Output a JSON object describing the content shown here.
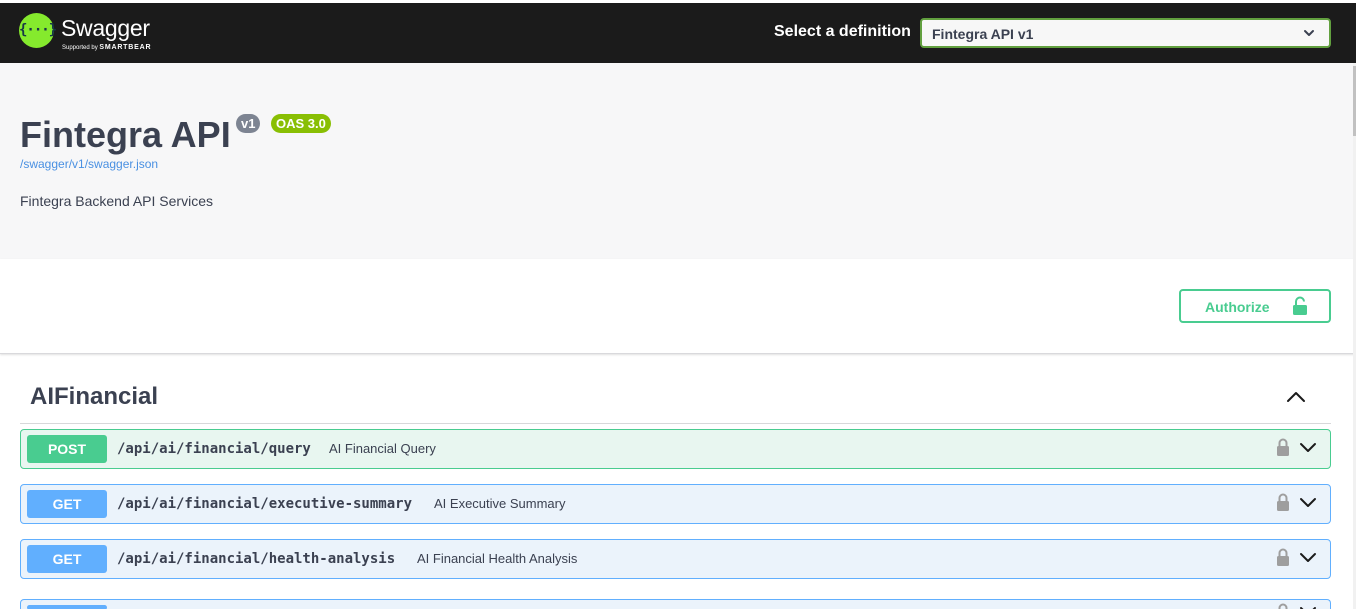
{
  "topbar": {
    "brand": "Swagger",
    "brand_sub_prefix": "Supported by",
    "brand_sub_company": "SMARTBEAR",
    "logo_glyph": "{···}",
    "definition_label": "Select a definition",
    "definition_selected": "Fintegra API v1"
  },
  "info": {
    "title": "Fintegra API",
    "version_badge": "v1",
    "oas_badge": "OAS 3.0",
    "spec_link": "/swagger/v1/swagger.json",
    "description": "Fintegra Backend API Services"
  },
  "authorize": {
    "label": "Authorize",
    "icon": "unlocked-padlock-icon"
  },
  "tag": {
    "name": "AIFinancial",
    "expanded": true,
    "toggle_icon": "chevron-up-icon"
  },
  "operations": [
    {
      "method": "POST",
      "path": "/api/ai/financial/query",
      "summary": "AI Financial Query",
      "lock_icon": "padlock-icon",
      "expand_icon": "chevron-down-icon"
    },
    {
      "method": "GET",
      "path": "/api/ai/financial/executive-summary",
      "summary": "AI Executive Summary",
      "lock_icon": "padlock-icon",
      "expand_icon": "chevron-down-icon"
    },
    {
      "method": "GET",
      "path": "/api/ai/financial/health-analysis",
      "summary": "AI Financial Health Analysis",
      "lock_icon": "padlock-icon",
      "expand_icon": "chevron-down-icon"
    },
    {
      "method": "GET",
      "path": "",
      "summary": "",
      "lock_icon": "padlock-icon",
      "expand_icon": "chevron-down-icon"
    }
  ],
  "colors": {
    "topbar_bg": "#1b1b1b",
    "swagger_green": "#85ea2d",
    "post": "#49cc90",
    "get": "#61affe",
    "badge_version": "#7d8492",
    "badge_oas": "#89bf04",
    "link": "#4990e2"
  }
}
